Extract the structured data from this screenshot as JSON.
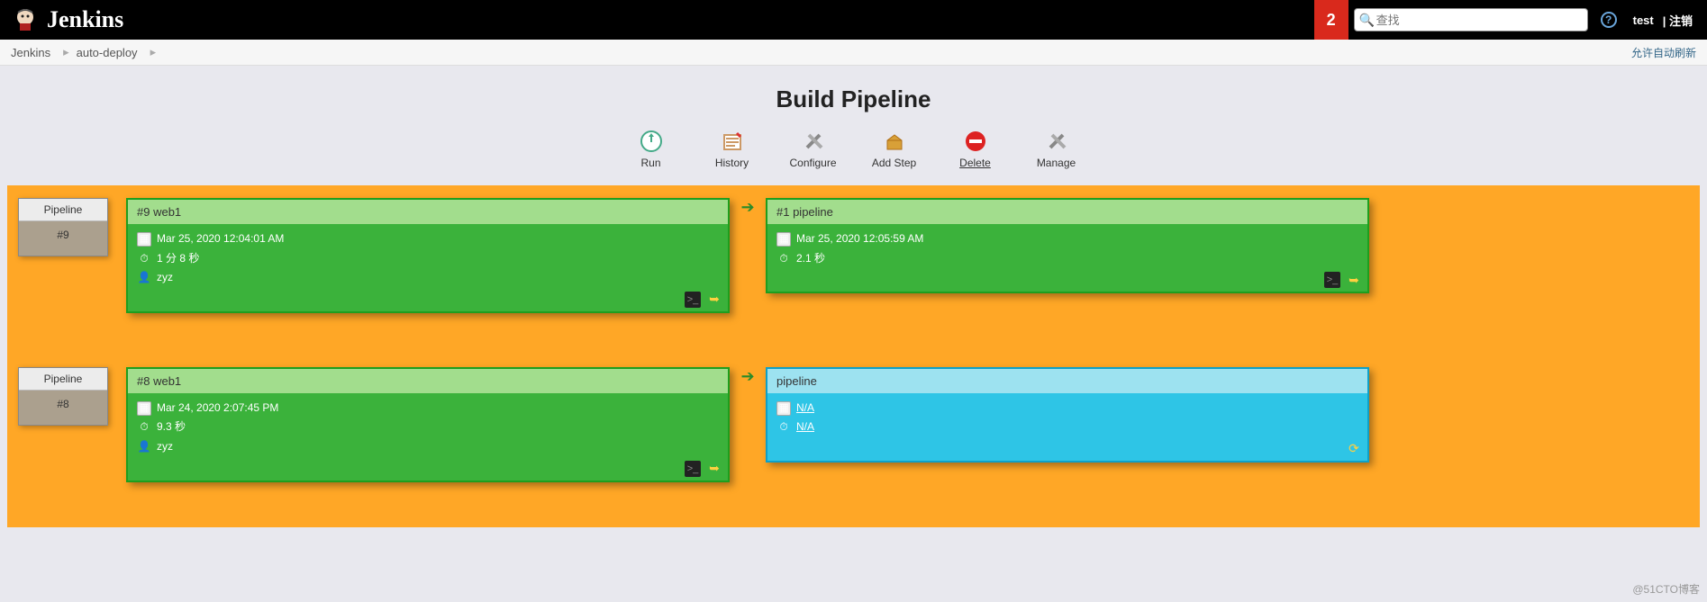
{
  "header": {
    "brand": "Jenkins",
    "notif_count": "2",
    "search_placeholder": "查找",
    "user": "test",
    "logout": "| 注销"
  },
  "breadcrumb": {
    "items": [
      "Jenkins",
      "auto-deploy"
    ],
    "auto_refresh": "允许自动刷新"
  },
  "title": "Build Pipeline",
  "toolbar": {
    "run": "Run",
    "history": "History",
    "configure": "Configure",
    "add_step": "Add Step",
    "delete": "Delete",
    "manage": "Manage"
  },
  "pipelines": [
    {
      "label_top": "Pipeline",
      "label_num": "#9",
      "stages": [
        {
          "style": "green",
          "title": "#9 web1",
          "date": "Mar 25, 2020 12:04:01 AM",
          "duration": "1 分 8 秒",
          "user": "zyz",
          "actions": [
            "console",
            "rerun"
          ]
        },
        {
          "style": "green",
          "title": "#1 pipeline",
          "date": "Mar 25, 2020 12:05:59 AM",
          "duration": "2.1 秒",
          "user": "",
          "actions": [
            "console",
            "rerun"
          ]
        }
      ]
    },
    {
      "label_top": "Pipeline",
      "label_num": "#8",
      "stages": [
        {
          "style": "green",
          "title": "#8 web1",
          "date": "Mar 24, 2020 2:07:45 PM",
          "duration": "9.3 秒",
          "user": "zyz",
          "actions": [
            "console",
            "rerun"
          ]
        },
        {
          "style": "blue",
          "title": "pipeline",
          "na1": "N/A",
          "na2": "N/A",
          "actions": [
            "spinner"
          ]
        }
      ]
    }
  ],
  "watermark": "@51CTO博客"
}
